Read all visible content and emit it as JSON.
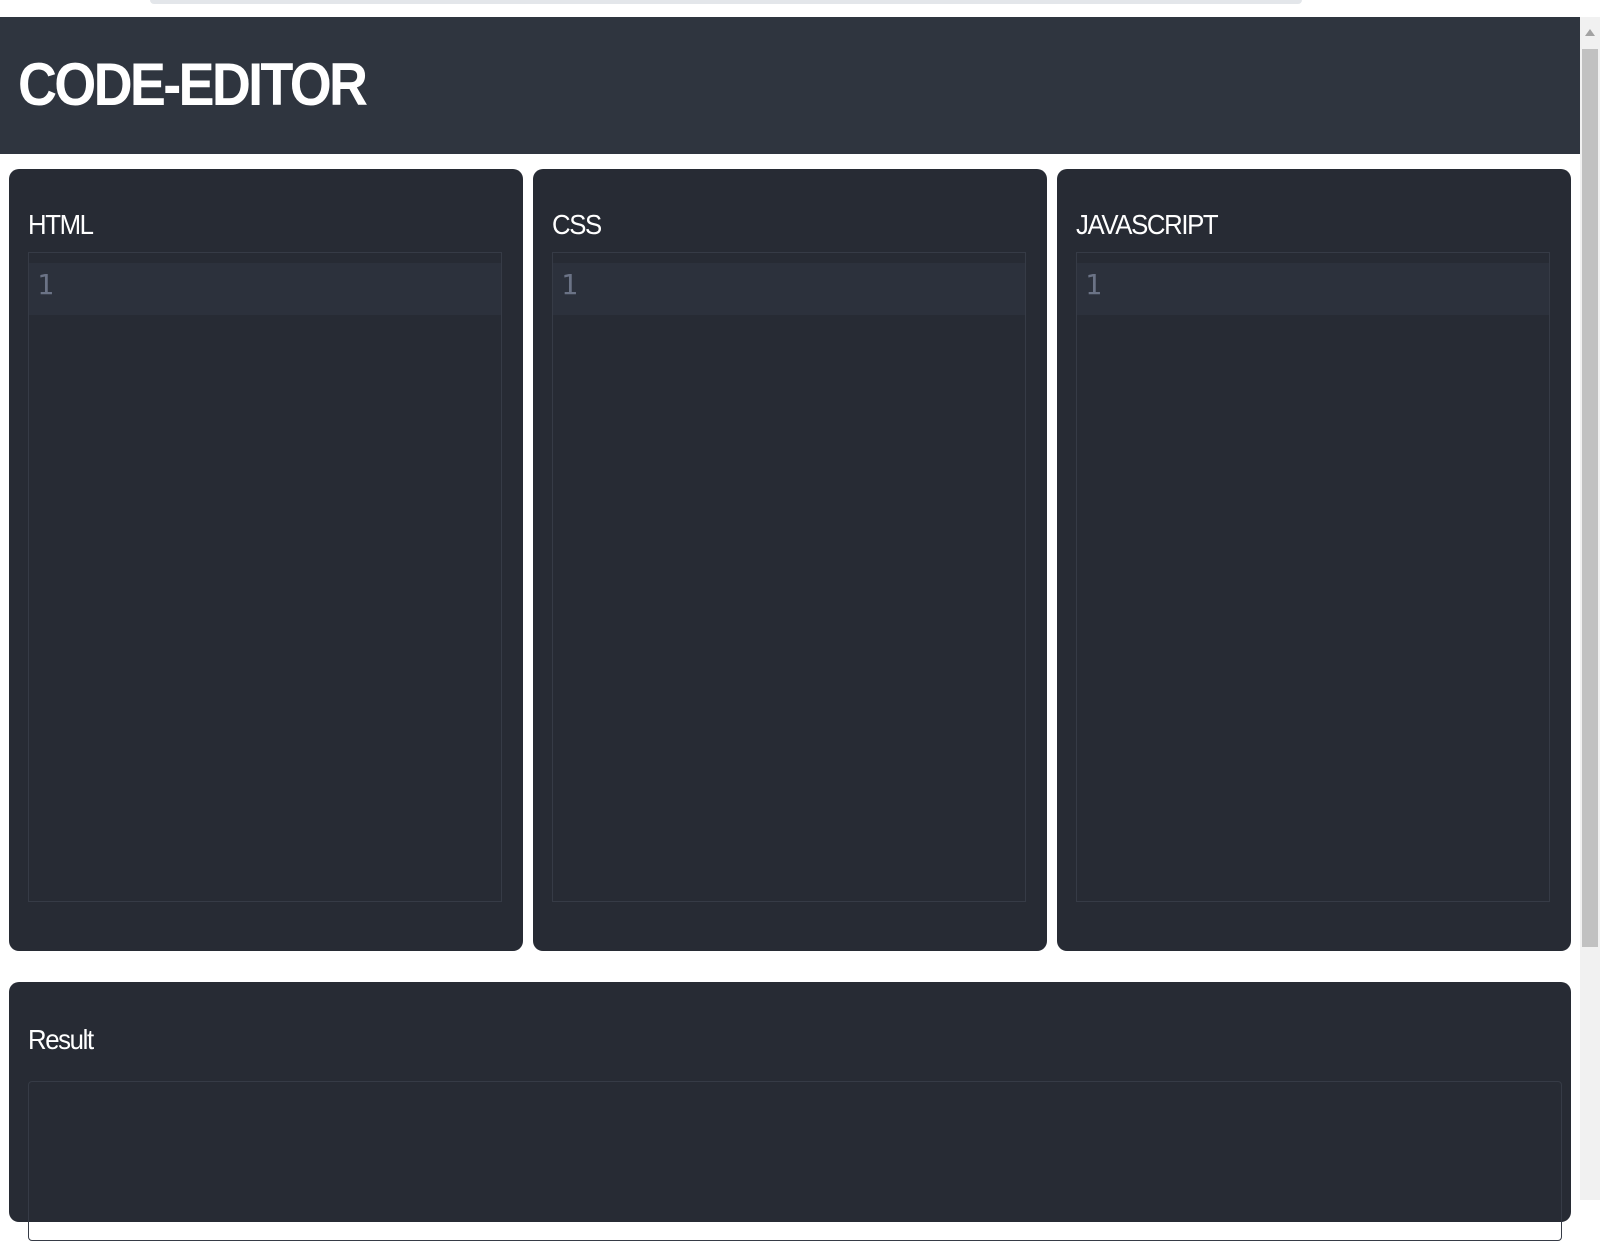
{
  "header": {
    "title": "CODE-EDITOR"
  },
  "panels": [
    {
      "label": "HTML",
      "line_number": "1",
      "content": ""
    },
    {
      "label": "CSS",
      "line_number": "1",
      "content": ""
    },
    {
      "label": "JAVASCRIPT",
      "line_number": "1",
      "content": ""
    }
  ],
  "result": {
    "label": "Result"
  },
  "colors": {
    "header_bg": "#2f353f",
    "panel_bg": "#272b34",
    "text": "#ffffff",
    "line_number": "#6b7386"
  }
}
